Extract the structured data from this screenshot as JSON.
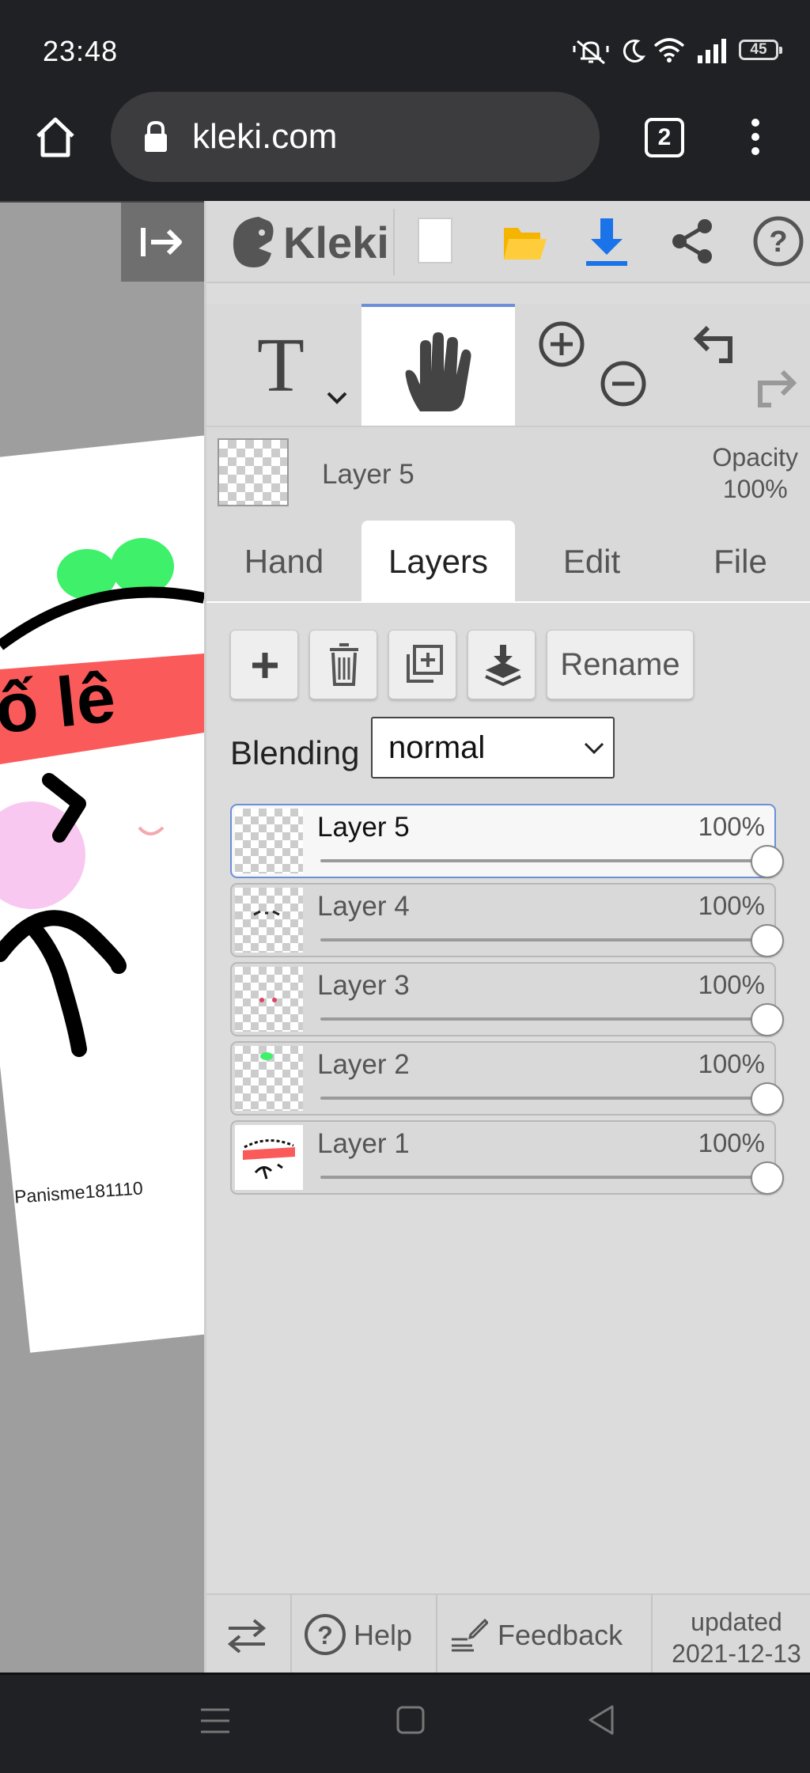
{
  "status_bar": {
    "time": "23:48",
    "battery": "45",
    "icons": [
      "mute-bell-icon",
      "moon-icon",
      "wifi-icon",
      "signal-icon",
      "battery-icon"
    ]
  },
  "browser": {
    "url": "kleki.com",
    "tab_count": "2",
    "icons": [
      "home-icon",
      "lock-icon",
      "kebab-menu-icon"
    ]
  },
  "canvas": {
    "drawing_text": "ố lê",
    "signature": "Panisme181110"
  },
  "app": {
    "logo_text": "Kleki",
    "toolbar_icons": [
      "new-image-icon",
      "open-folder-icon",
      "download-icon",
      "share-icon",
      "help-icon"
    ],
    "tools": {
      "text_tool_glyph": "T",
      "icons": [
        "hand-icon",
        "zoom-in-icon",
        "zoom-out-icon",
        "undo-icon",
        "redo-icon"
      ]
    },
    "active_layer": {
      "name": "Layer 5",
      "opacity_label": "Opacity",
      "opacity_value": "100%"
    },
    "tabs": [
      {
        "label": "Hand",
        "active": false
      },
      {
        "label": "Layers",
        "active": true
      },
      {
        "label": "Edit",
        "active": false
      },
      {
        "label": "File",
        "active": false
      }
    ],
    "layer_buttons": {
      "rename_label": "Rename",
      "icons": [
        "add-layer-icon",
        "delete-layer-icon",
        "duplicate-layer-icon",
        "merge-down-icon"
      ]
    },
    "blending": {
      "label": "Blending",
      "value": "normal"
    },
    "layers": [
      {
        "name": "Layer 5",
        "opacity": "100%",
        "opacity_fraction": 1.0,
        "active": true
      },
      {
        "name": "Layer 4",
        "opacity": "100%",
        "opacity_fraction": 1.0,
        "active": false
      },
      {
        "name": "Layer 3",
        "opacity": "100%",
        "opacity_fraction": 1.0,
        "active": false
      },
      {
        "name": "Layer 2",
        "opacity": "100%",
        "opacity_fraction": 1.0,
        "active": false
      },
      {
        "name": "Layer 1",
        "opacity": "100%",
        "opacity_fraction": 1.0,
        "active": false
      }
    ],
    "footer": {
      "help_label": "Help",
      "feedback_label": "Feedback",
      "updated_label": "updated",
      "updated_date": "2021-12-13"
    }
  },
  "nav_bar": {
    "icons": [
      "recents-icon",
      "home-square-icon",
      "back-triangle-icon"
    ]
  },
  "colors": {
    "accent_blue": "#6b8fd8",
    "download_blue": "#1a73e8",
    "folder_yellow": "#f4b400",
    "panel_bg": "#dcdcdc"
  }
}
